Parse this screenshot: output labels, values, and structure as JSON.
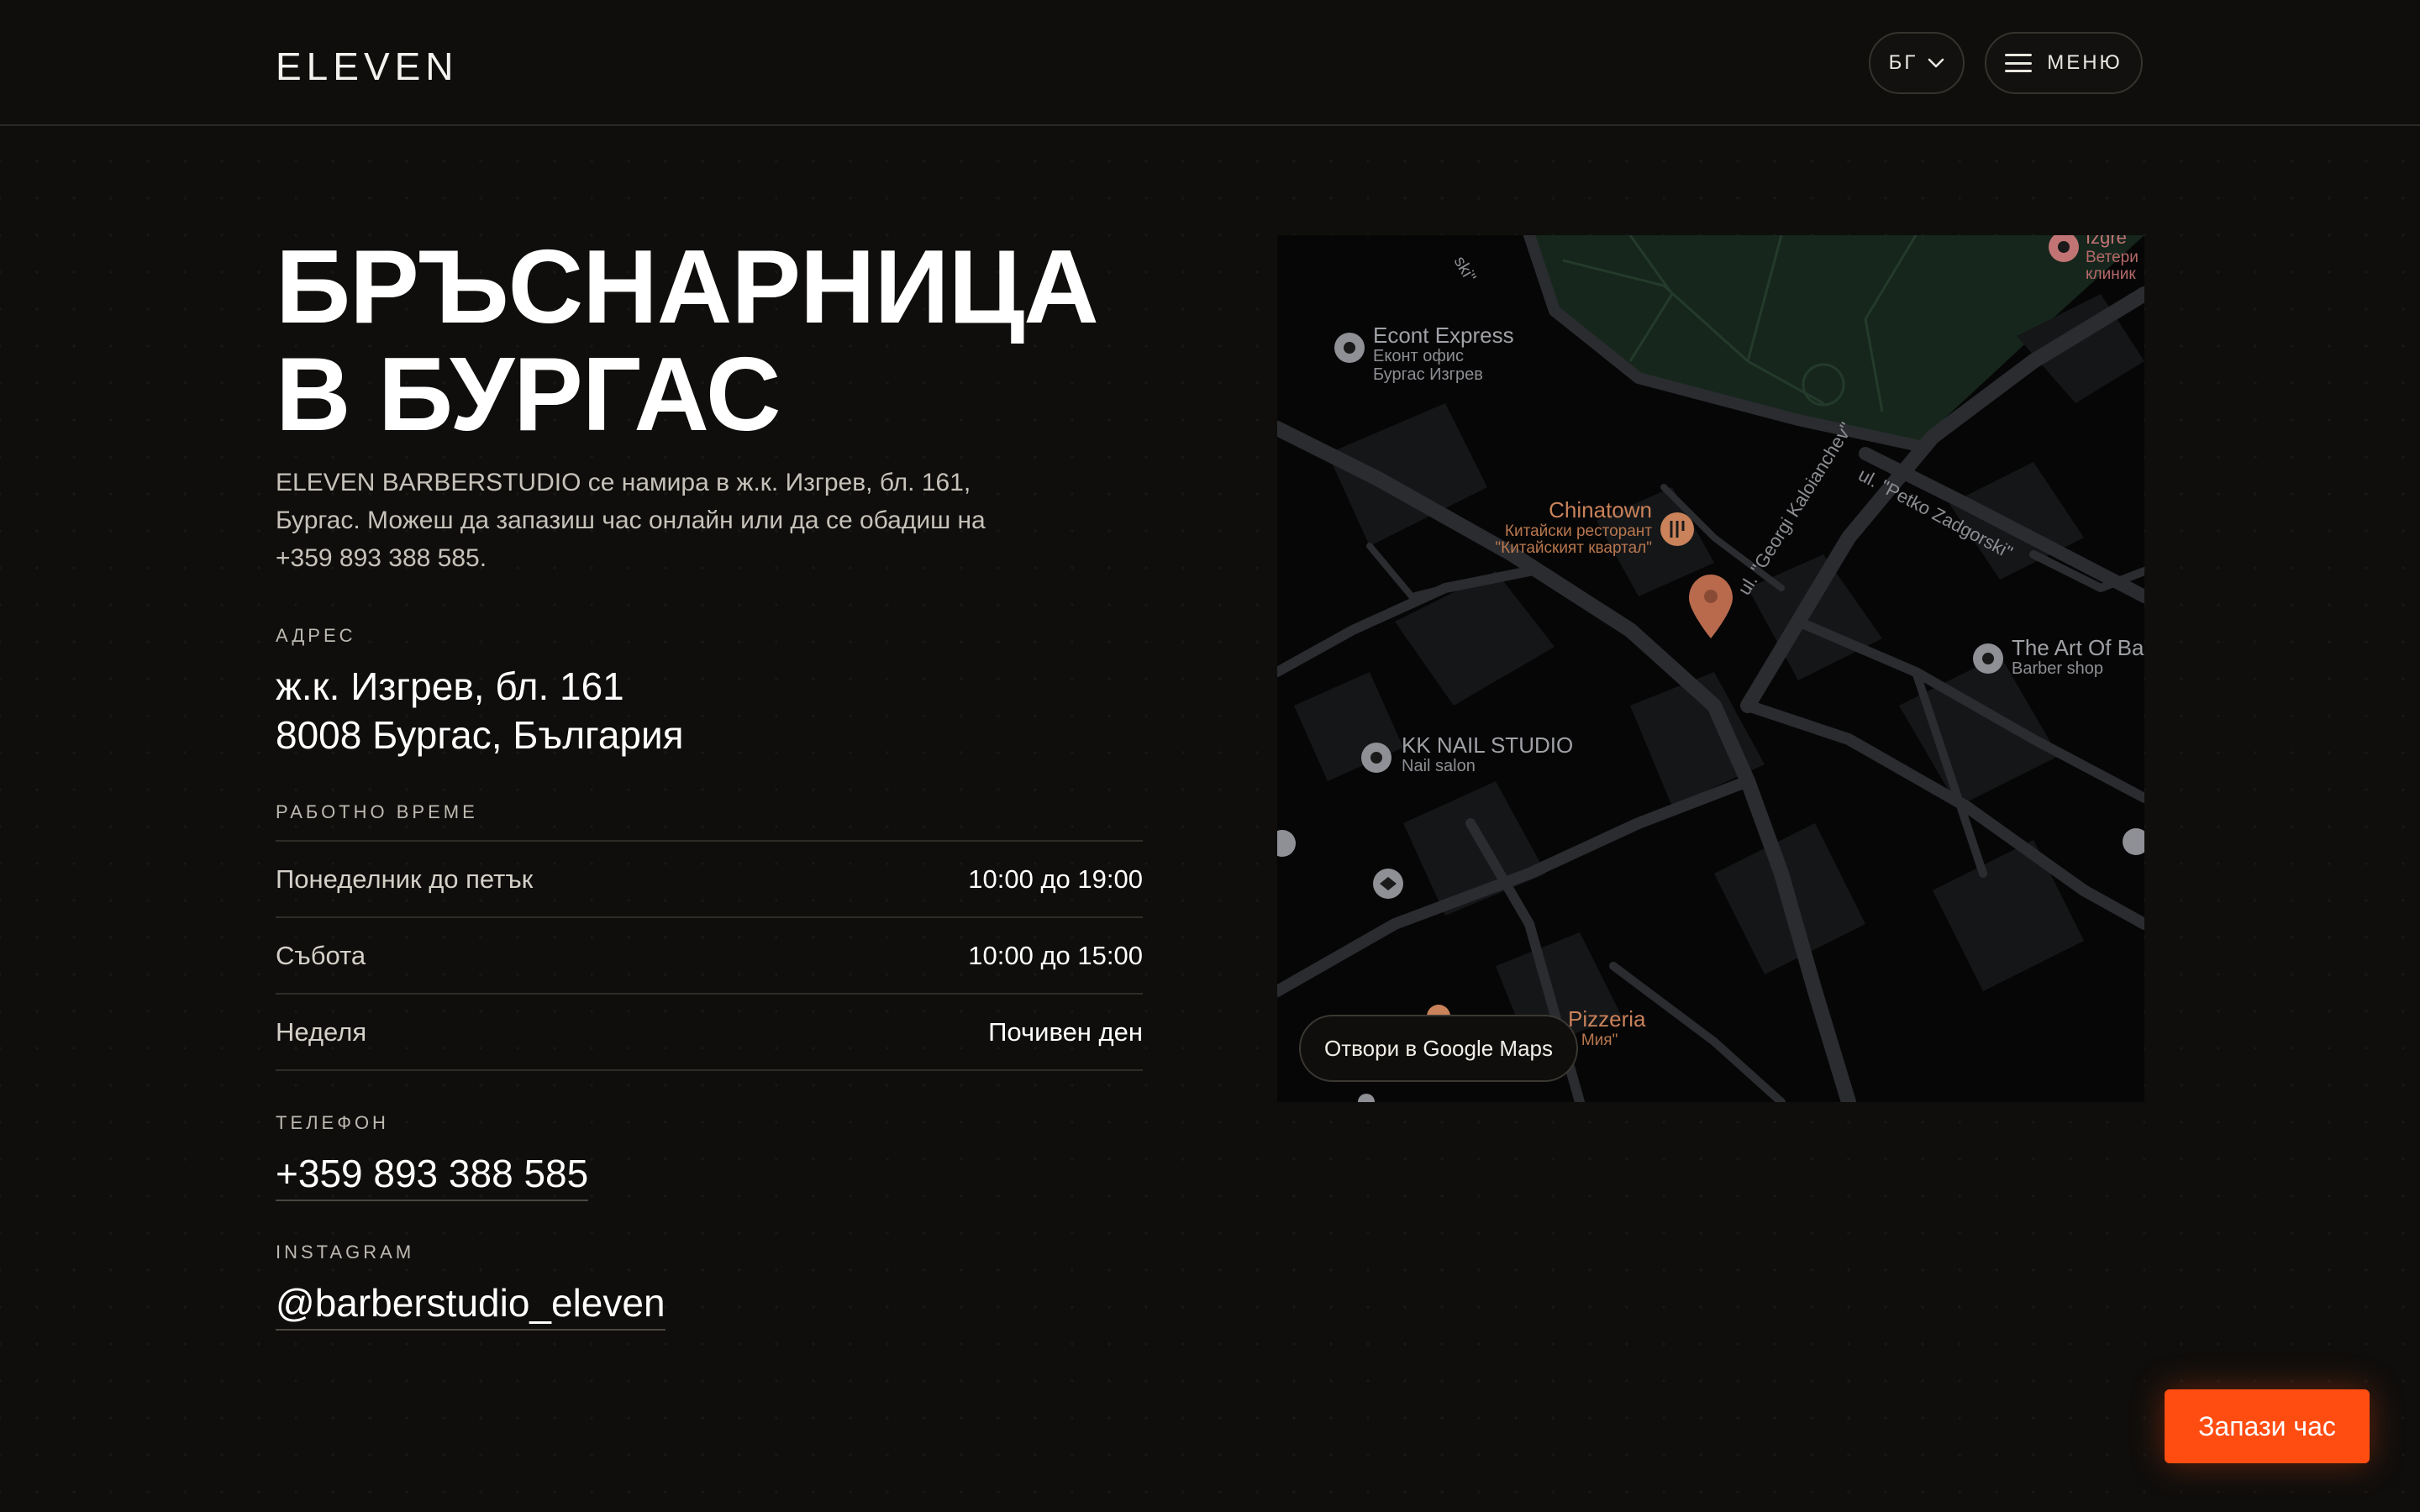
{
  "header": {
    "logo": "ELEVEN",
    "lang_label": "БГ",
    "menu_label": "МЕНЮ"
  },
  "hero": {
    "title_line1": "БРЪСНАРНИЦА",
    "title_line2": "В БУРГАС",
    "intro": "ELEVEN BARBERSTUDIO се намира в ж.к. Изгрев, бл. 161, Бургас. Можеш да запазиш час онлайн или да се обадиш на +359 893 388 585."
  },
  "address": {
    "label": "АДРЕС",
    "line1": "ж.к. Изгрев, бл. 161",
    "line2": "8008 Бургас, България"
  },
  "hours": {
    "label": "РАБОТНО ВРЕМЕ",
    "rows": [
      {
        "day": "Понеделник до петък",
        "time": "10:00 до 19:00"
      },
      {
        "day": "Събота",
        "time": "10:00 до 15:00"
      },
      {
        "day": "Неделя",
        "time": "Почивен ден"
      }
    ]
  },
  "phone": {
    "label": "ТЕЛЕФОН",
    "value": "+359 893 388 585"
  },
  "instagram": {
    "label": "INSTAGRAM",
    "value": "@barberstudio_eleven"
  },
  "map": {
    "open_button": "Отвори в Google Maps",
    "places": {
      "econt_name": "Econt Express",
      "econt_sub1": "Еконт офис",
      "econt_sub2": "Бургас Изгрев",
      "chinatown_name": "Chinatown",
      "chinatown_sub1": "Китайски ресторант",
      "chinatown_sub2": "\"Китайският квартал\"",
      "street_georgi": "ul. \"Georgi Kaloianchev\"",
      "street_petko": "ul. \"Petko Zadgorski\"",
      "artof_name": "The Art Of Ba",
      "artof_sub": "Barber shop",
      "nail_name": "KK NAIL STUDIO",
      "nail_sub": "Nail salon",
      "pizzeria_name": "Pizzeria",
      "pizzeria_sub": "а Мия\"",
      "vet_name": "Izgre",
      "vet_sub1": "Ветери",
      "vet_sub2": "клиник",
      "top_street": "ski\""
    },
    "colors": {
      "park": "#16261c",
      "road": "#2a2c30",
      "building": "#151618",
      "poi_label": "#c9825a",
      "pin": "#b96a4d"
    }
  },
  "cta": {
    "book_label": "Запази час"
  },
  "colors": {
    "accent": "#ff4d12",
    "background": "#0f0e0c"
  }
}
